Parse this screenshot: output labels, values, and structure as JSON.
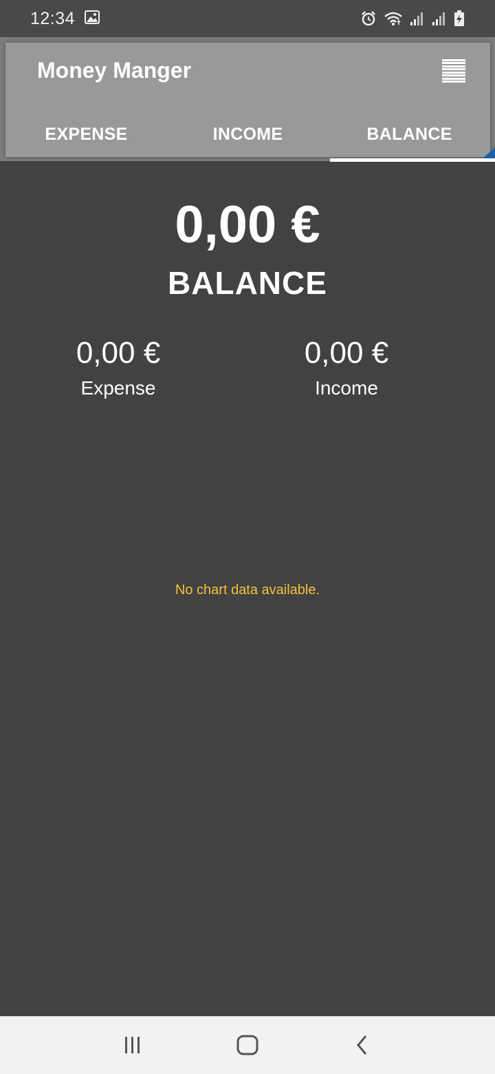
{
  "status_bar": {
    "time": "12:34",
    "icons": [
      "image-icon",
      "alarm-icon",
      "wifi-icon",
      "signal-icon",
      "signal-icon-2",
      "battery-charging-icon"
    ]
  },
  "app_bar": {
    "title": "Money Manger",
    "menu_icon": "menu-icon"
  },
  "tabs": [
    {
      "label": "EXPENSE",
      "selected": false
    },
    {
      "label": "INCOME",
      "selected": false
    },
    {
      "label": "BALANCE",
      "selected": true
    }
  ],
  "balance": {
    "amount": "0,00 €",
    "label": "BALANCE"
  },
  "summary": {
    "expense": {
      "value": "0,00 €",
      "label": "Expense"
    },
    "income": {
      "value": "0,00 €",
      "label": "Income"
    }
  },
  "chart": {
    "empty_message": "No chart data available."
  },
  "nav_bar": {
    "icons": [
      "recent-apps-icon",
      "home-icon",
      "back-icon"
    ]
  },
  "colors": {
    "background": "#424242",
    "app_bar": "#999999",
    "status_bar": "#4a4949",
    "empty_text": "#f3c13a",
    "nav_bar": "#f2f2f2"
  }
}
